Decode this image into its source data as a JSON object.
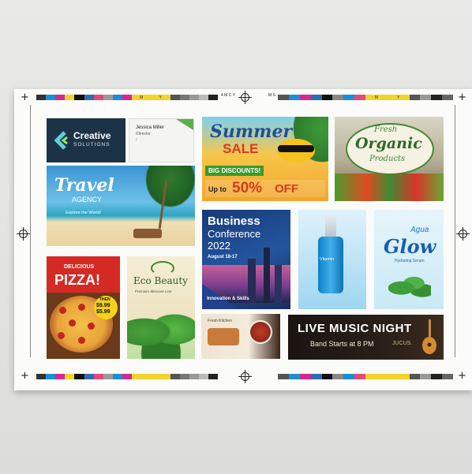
{
  "print_marks": {
    "strip_letters": [
      "M",
      "Y",
      "M",
      "Y"
    ],
    "note_small": "4 M  C  Y",
    "note_small2": "M S"
  },
  "panels": {
    "creative": {
      "title": "Creative",
      "sub": "SOLUTIONS",
      "bg": "#1c3347"
    },
    "card": {
      "name": "Jessica Miller",
      "role": "/Director",
      "line": "/"
    },
    "summer": {
      "word1": "Summer",
      "word2": "SALE",
      "badge": "BIG DISCOUNTS!",
      "upto": "Up to",
      "pct": "50%",
      "off": "OFF"
    },
    "organic": {
      "fresh": "Fresh",
      "organic": "Organic",
      "products": "Products"
    },
    "travel": {
      "title": "Travel",
      "sub": "AGENCY",
      "tagline": "Explore the World!"
    },
    "business": {
      "title": "Business",
      "title2": "Conference",
      "year": "2022",
      "date": "August 18-17",
      "footer": "Innovation & Skills"
    },
    "serum": {
      "label": "Vitamin"
    },
    "glow": {
      "agua": "Agua",
      "glow": "Glow",
      "sub": "Hydrating Serum"
    },
    "pizza": {
      "label1": "DELICIOUS",
      "label2": "PIZZA!",
      "price_then": "THEN",
      "price1": "$9.99",
      "price2": "$5.99"
    },
    "eco": {
      "title": "Eco Beauty",
      "sub": "Premium Skincare Line"
    },
    "food": {
      "label": "Fresh Kitchen"
    },
    "music": {
      "title": "LIVE MUSIC NIGHT",
      "sub": "Band Starts at 8 PM",
      "tail": "JUCUS."
    }
  }
}
